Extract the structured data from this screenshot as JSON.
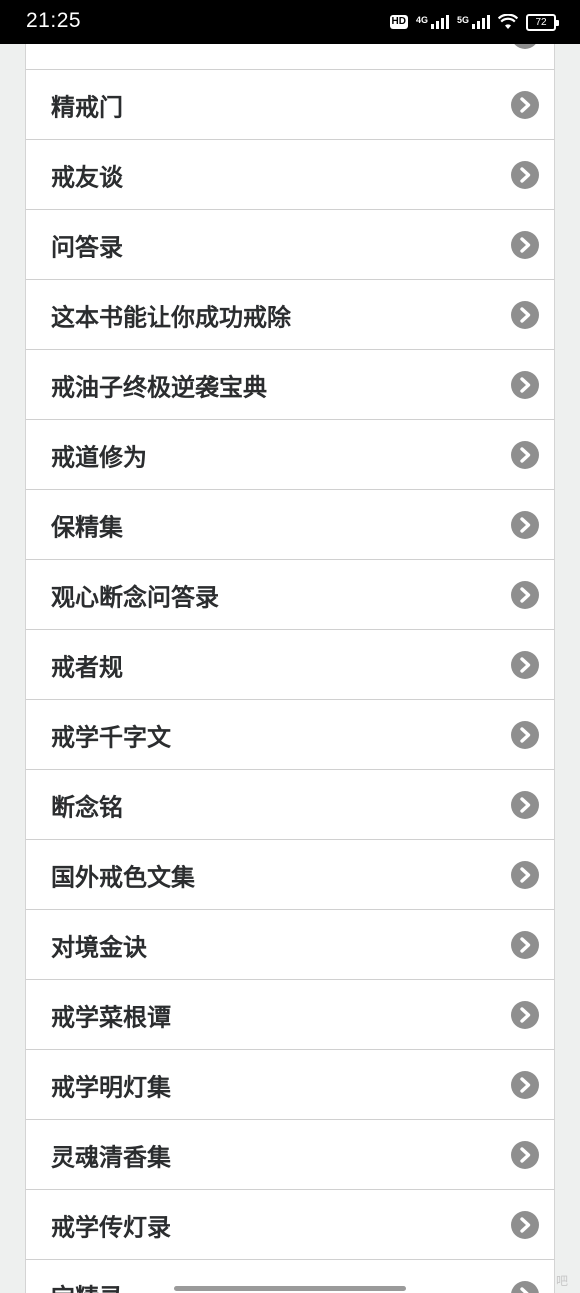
{
  "status_bar": {
    "time": "21:25",
    "network_badge": "HD",
    "signal_1_label": "4G",
    "signal_2_label": "5G",
    "battery_level": "72",
    "icons": [
      "hd-icon",
      "signal-4g-icon",
      "signal-5g-icon",
      "wifi-icon",
      "battery-icon"
    ]
  },
  "list": {
    "partial_top_item": "",
    "items": [
      {
        "label": "精戒门"
      },
      {
        "label": "戒友谈"
      },
      {
        "label": "问答录"
      },
      {
        "label": "这本书能让你成功戒除"
      },
      {
        "label": "戒油子终极逆袭宝典"
      },
      {
        "label": "戒道修为"
      },
      {
        "label": "保精集"
      },
      {
        "label": "观心断念问答录"
      },
      {
        "label": "戒者规"
      },
      {
        "label": "戒学千字文"
      },
      {
        "label": "断念铭"
      },
      {
        "label": "国外戒色文集"
      },
      {
        "label": "对境金诀"
      },
      {
        "label": "戒学菜根谭"
      },
      {
        "label": "戒学明灯集"
      },
      {
        "label": "灵魂清香集"
      },
      {
        "label": "戒学传灯录"
      },
      {
        "label": "宝精录"
      }
    ],
    "item_icon": "chevron-right-icon",
    "chevron_color": "#8f8f8f"
  },
  "watermark": "吧"
}
